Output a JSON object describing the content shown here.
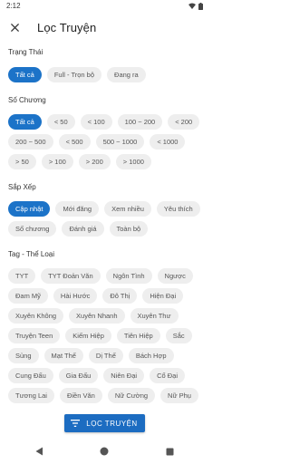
{
  "status_bar": {
    "time": "2:12"
  },
  "app_bar": {
    "title": "Lọc Truyện"
  },
  "sections": {
    "status": {
      "label": "Trạng Thái",
      "chips": [
        "Tất cả",
        "Full - Trọn bộ",
        "Đang ra"
      ],
      "selected": "Tất cả"
    },
    "chapters": {
      "label": "Số Chương",
      "chips": [
        "Tất cả",
        "< 50",
        "< 100",
        "100 ~ 200",
        "< 200",
        "200 ~ 500",
        "< 500",
        "500 ~ 1000",
        "< 1000",
        "> 50",
        "> 100",
        "> 200",
        "> 1000"
      ],
      "selected": "Tất cả"
    },
    "sort": {
      "label": "Sắp Xếp",
      "chips": [
        "Cập nhật",
        "Mới đăng",
        "Xem nhiều",
        "Yêu thích",
        "Số chương",
        "Đánh giá",
        "Toàn bộ"
      ],
      "selected": "Cập nhật"
    },
    "tags": {
      "label": "Tag - Thể Loại",
      "chips": [
        "TYT",
        "TYT Đoản Văn",
        "Ngôn Tình",
        "Ngược",
        "Đam Mỹ",
        "Hài Hước",
        "Đô Thị",
        "Hiện Đại",
        "Xuyên Không",
        "Xuyên Nhanh",
        "Xuyên Thư",
        "Truyện Teen",
        "Kiếm Hiệp",
        "Tiên Hiệp",
        "Sắc",
        "Sủng",
        "Mạt Thế",
        "Dị Thế",
        "Bách Hợp",
        "Cung Đấu",
        "Gia Đấu",
        "Niên Đại",
        "Cổ Đại",
        "Tương Lai",
        "Điền Văn",
        "Nữ Cường",
        "Nữ Phụ"
      ],
      "selected": ""
    }
  },
  "filter_button": {
    "label": "LỌC TRUYỆN"
  },
  "colors": {
    "accent": "#1c73c8",
    "chip_bg": "#eeeeee",
    "chip_text": "#555555"
  },
  "icons": {
    "close": "close-icon",
    "filter": "filter-list-icon",
    "wifi": "wifi-icon",
    "battery": "battery-icon",
    "gear": "gear-icon",
    "back": "back-icon",
    "home": "home-icon",
    "recents": "recents-icon"
  }
}
